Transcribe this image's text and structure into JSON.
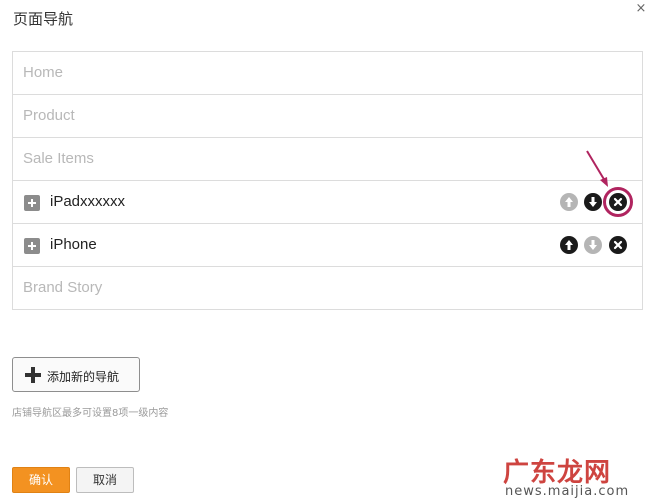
{
  "dialog": {
    "title": "页面导航",
    "close_symbol": "×"
  },
  "nav_items": [
    {
      "label": "Home",
      "state": "placeholder"
    },
    {
      "label": "Product",
      "state": "placeholder"
    },
    {
      "label": "Sale Items",
      "state": "placeholder"
    },
    {
      "label": "iPadxxxxxx",
      "state": "active",
      "controls": {
        "up": "disabled",
        "down": "enabled",
        "delete": "enabled",
        "delete_highlighted": true
      }
    },
    {
      "label": "iPhone",
      "state": "active",
      "controls": {
        "up": "enabled",
        "down": "disabled",
        "delete": "enabled"
      }
    },
    {
      "label": "Brand Story",
      "state": "placeholder"
    }
  ],
  "icons": {
    "expand": "plus-square-icon",
    "move_up": "arrow-up-circle-icon",
    "move_down": "arrow-down-circle-icon",
    "delete": "x-circle-icon",
    "add": "plus-icon",
    "close": "close-icon"
  },
  "add_button": {
    "label": "添加新的导航"
  },
  "hint": "店铺导航区最多可设置8项一级内容",
  "footer": {
    "confirm_label": "确认",
    "cancel_label": "取消"
  },
  "watermark": {
    "main": "广东龙网",
    "sub": "news.maijia.com"
  },
  "colors": {
    "accent": "#f39221",
    "annotation": "#b0245f",
    "control_enabled": "#1a1a1a",
    "control_disabled": "#b5b5b5",
    "placeholder_text": "#b8b8b8"
  }
}
